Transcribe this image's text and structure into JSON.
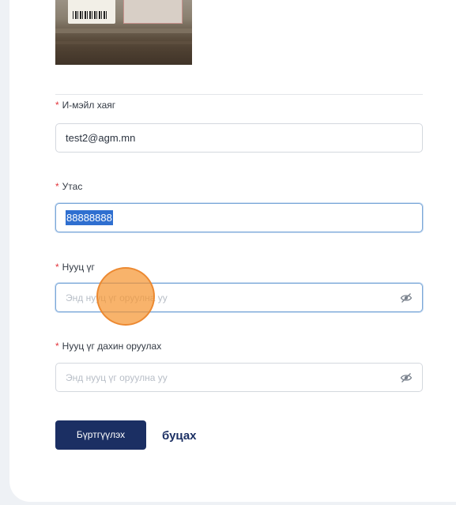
{
  "form": {
    "email": {
      "label": "И-мэйл хаяг",
      "value": "test2@agm.mn"
    },
    "phone": {
      "label": "Утас",
      "value": "88888888"
    },
    "password": {
      "label": "Нууц үг",
      "placeholder": "Энд нууц үг оруулна уу"
    },
    "password_confirm": {
      "label": "Нууц үг дахин оруулах",
      "placeholder": "Энд нууц үг оруулна уу"
    },
    "required_mark": "*",
    "submit_label": "Бүртгүүлэх",
    "back_label": "буцах"
  },
  "icons": {
    "password_toggle": "eye-slash-icon"
  },
  "colors": {
    "primary": "#1b2f63",
    "required": "#e2333a",
    "focus_border": "#7aa7d8",
    "cursor": "#f5963a"
  }
}
